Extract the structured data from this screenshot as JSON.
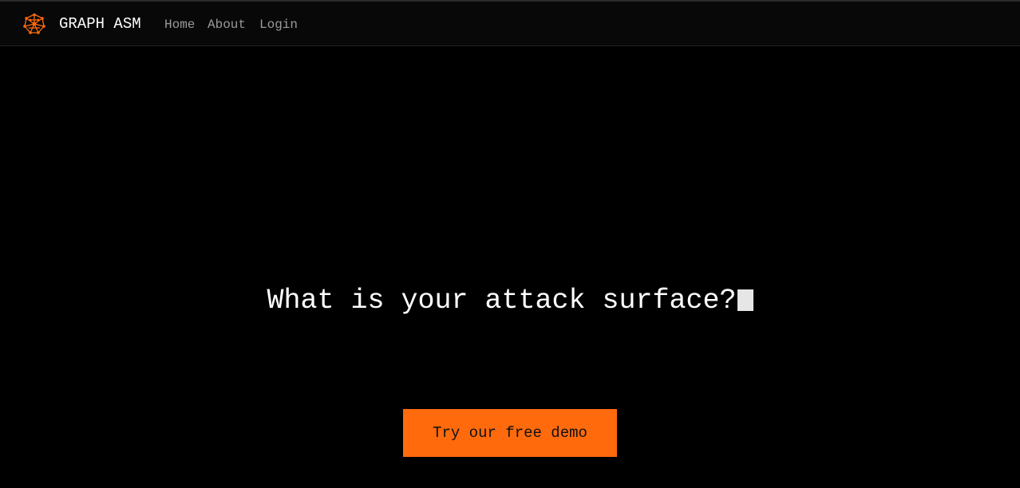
{
  "header": {
    "brand": "GRAPH ASM",
    "logo_icon": "network-graph-icon",
    "nav": [
      {
        "label": "Home"
      },
      {
        "label": "About"
      },
      {
        "label": "Login"
      }
    ]
  },
  "hero": {
    "title": "What is your attack surface?",
    "cta_label": "Try our free demo"
  },
  "colors": {
    "background": "#000000",
    "navbar": "#080808",
    "accent": "#ff6a0d",
    "nav_link": "#9a9a9a",
    "text": "#ffffff"
  }
}
